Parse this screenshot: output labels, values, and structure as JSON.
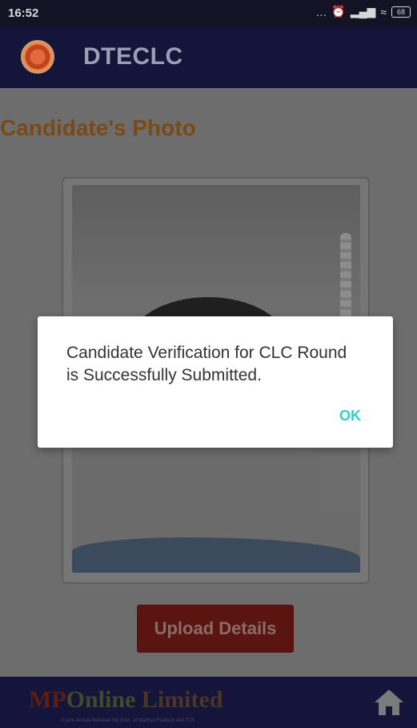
{
  "status_bar": {
    "time": "16:52",
    "icons": [
      "more-dots-icon",
      "alarm-icon",
      "sim-icon",
      "signal-icon",
      "signal-icon",
      "wifi-icon"
    ],
    "battery": "68"
  },
  "app_bar": {
    "title": "DTECLC",
    "logo": "emblem-logo"
  },
  "page": {
    "title": "Candidate's Photo"
  },
  "upload_button": {
    "label": "Upload Details"
  },
  "footer": {
    "logo_mp": "MP",
    "logo_online": "Online",
    "logo_limited": " Limited",
    "tagline": "A joint venture between the Govt. of Madhya Pradesh and TCS",
    "home_icon": "home-icon"
  },
  "dialog": {
    "message": "Candidate Verification for CLC Round is Successfully Submitted.",
    "ok_label": "OK"
  }
}
